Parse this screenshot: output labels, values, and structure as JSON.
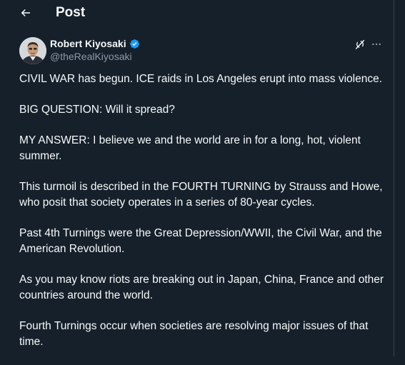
{
  "header": {
    "title": "Post",
    "back_icon": "arrow-left-icon"
  },
  "author": {
    "name": "Robert Kiyosaki",
    "handle": "@theRealKiyosaki",
    "verified": true,
    "verified_color": "#1d9bf0"
  },
  "actions": {
    "grok_icon": "grok-icon",
    "more_icon": "more-horizontal-icon"
  },
  "tweet": {
    "paragraphs": [
      "CIVIL WAR has begun.  ICE raids in Los Angeles erupt into mass violence.",
      "BIG QUESTION:  Will it spread?",
      "MY ANSWER:  I believe we and the world are in for a long, hot, violent summer.",
      "This turmoil is described in the FOURTH TURNING by  Strauss and Howe, who posit that society operates in a series of 80-year cycles.",
      "Past 4th Turnings were the Great Depression/WWII, the Civil War, and the American Revolution.",
      "As you may know riots are breaking out in Japan, China, France and other countries  around the world.",
      "Fourth Turnings occur when societies are resolving major issues of that time."
    ]
  },
  "colors": {
    "background": "#15202b",
    "text": "#f7f9f9",
    "secondary_text": "#8b98a5",
    "border": "#38444d"
  }
}
